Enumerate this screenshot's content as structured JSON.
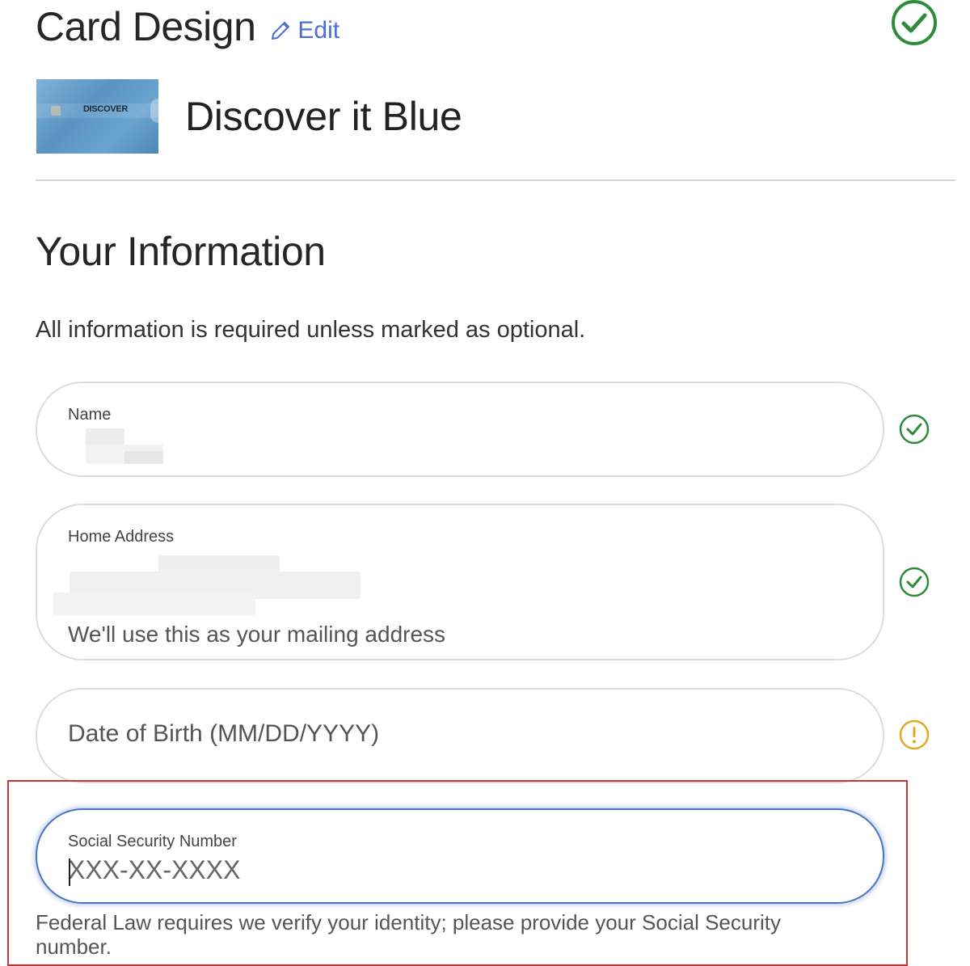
{
  "card_design": {
    "title": "Card Design",
    "edit_label": "Edit",
    "card_name": "Discover it Blue",
    "card_brand_text": "DISCOVER"
  },
  "your_information": {
    "title": "Your Information",
    "note": "All information is required unless marked as optional."
  },
  "fields": {
    "name": {
      "label": "Name",
      "status": "valid"
    },
    "home_address": {
      "label": "Home Address",
      "hint": "We'll use this as your mailing address",
      "status": "valid"
    },
    "dob": {
      "placeholder": "Date of Birth (MM/DD/YYYY)",
      "status": "warning"
    },
    "ssn": {
      "label": "Social Security Number",
      "placeholder": "XXX-XX-XXXX",
      "value": ""
    }
  },
  "legal": {
    "text": "Federal Law requires we verify your identity; please provide your Social Security number."
  },
  "colors": {
    "success": "#2e8b3a",
    "warning": "#e3a81c",
    "link": "#4a6fd1",
    "focus": "#4a73c4",
    "highlight": "#c9343a"
  }
}
